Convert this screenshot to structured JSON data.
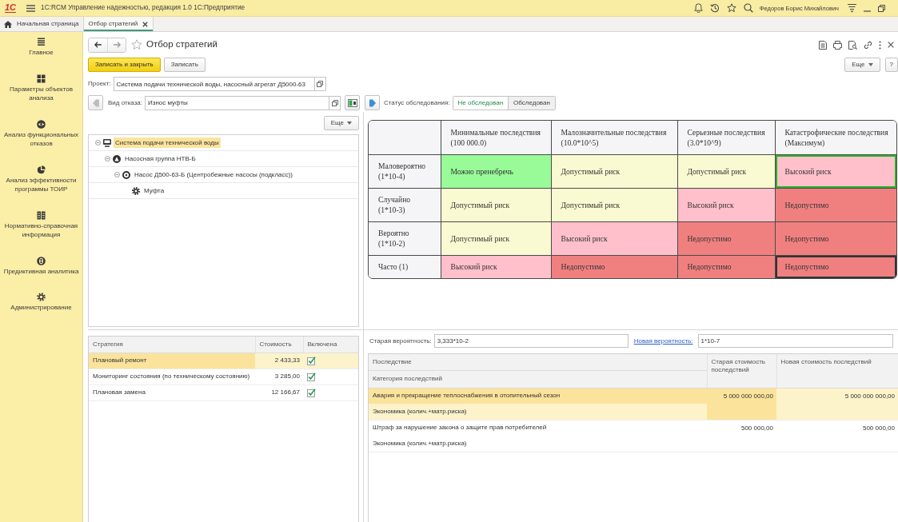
{
  "window": {
    "logo": "1С",
    "title": "1С:RCM Управление надежностью, редакция 1.0 1С:Предприятие",
    "user": "Федоров Борис Михайлович"
  },
  "tabs": [
    {
      "label": "Начальная страница",
      "kind": "home",
      "selected": false
    },
    {
      "label": "Отбор стратегий",
      "kind": "form",
      "selected": true
    }
  ],
  "sidebar": {
    "items": [
      "Главное",
      "Параметры объектов анализа",
      "Анализ функциональных отказов",
      "Анализ эффективности программы ТОИР",
      "Нормативно-справочная информация",
      "Предиктивная аналитика",
      "Администрирование"
    ]
  },
  "form": {
    "title": "Отбор стратегий",
    "save_close_button": "Записать и закрыть",
    "save_button": "Записать",
    "more_button": "Еще",
    "help_button": "?",
    "project": {
      "label": "Проект:",
      "value": "Система подачи технической воды, насосный агрегат Д5000-63"
    },
    "failure_type": {
      "label": "Вид отказа:",
      "value": "Износ муфты"
    },
    "survey_status": {
      "label": "Статус обследования:",
      "options": [
        {
          "label": "Не обследован",
          "selected": true
        },
        {
          "label": "Обследован",
          "selected": false
        }
      ]
    }
  },
  "tree": {
    "more_button": "Еще",
    "nodes": [
      {
        "label": "Система подачи технической воды",
        "expanded": true,
        "selected": true,
        "children": [
          {
            "label": "Насосная группа НТВ-Б",
            "expanded": true,
            "selected": false,
            "children": [
              {
                "label": "Насос Д500-63-Б (Центробежные насосы (подкласс))",
                "expanded": true,
                "selected": false,
                "children": [
                  {
                    "label": "Муфта",
                    "selected": false
                  }
                ]
              }
            ]
          }
        ]
      }
    ]
  },
  "risk_matrix": {
    "columns": [
      "Минимальные последствия (100 000.0)",
      "Малозначительные последствия (10.0*10^5)",
      "Серьезные последствия (3.0*10^9)",
      "Катастрофические последствия (Максимум)"
    ],
    "rows": [
      {
        "label": "Маловероятно (1*10-4)",
        "cells": [
          {
            "text": "Можно пренебречь",
            "color": "#98fb98",
            "selected": false,
            "focused": false
          },
          {
            "text": "Допустимый риск",
            "color": "#fafad2",
            "selected": false,
            "focused": false
          },
          {
            "text": "Допустимый риск",
            "color": "#fafad2",
            "selected": false,
            "focused": false
          },
          {
            "text": "Высокий риск",
            "color": "#ffc0cb",
            "selected": true,
            "focused": false
          }
        ]
      },
      {
        "label": "Случайно (1*10-3)",
        "cells": [
          {
            "text": "Допустимый риск",
            "color": "#fafad2",
            "selected": false,
            "focused": false
          },
          {
            "text": "Допустимый риск",
            "color": "#fafad2",
            "selected": false,
            "focused": false
          },
          {
            "text": "Высокий риск",
            "color": "#ffc0cb",
            "selected": false,
            "focused": false
          },
          {
            "text": "Недопустимо",
            "color": "#f08080",
            "selected": false,
            "focused": false
          }
        ]
      },
      {
        "label": "Вероятно (1*10-2)",
        "cells": [
          {
            "text": "Допустимый риск",
            "color": "#fafad2",
            "selected": false,
            "focused": false
          },
          {
            "text": "Высокий риск",
            "color": "#ffc0cb",
            "selected": false,
            "focused": false
          },
          {
            "text": "Недопустимо",
            "color": "#f08080",
            "selected": false,
            "focused": false
          },
          {
            "text": "Недопустимо",
            "color": "#f08080",
            "selected": false,
            "focused": false
          }
        ]
      },
      {
        "label": "Часто (1)",
        "cells": [
          {
            "text": "Высокий риск",
            "color": "#ffc0cb",
            "selected": false,
            "focused": false
          },
          {
            "text": "Недопустимо",
            "color": "#f08080",
            "selected": false,
            "focused": false
          },
          {
            "text": "Недопустимо",
            "color": "#f08080",
            "selected": false,
            "focused": false
          },
          {
            "text": "Недопустимо",
            "color": "#f08080",
            "selected": false,
            "focused": true
          }
        ]
      }
    ]
  },
  "strategies": {
    "columns": [
      "Стратегия",
      "Стоимость",
      "Включена"
    ],
    "rows": [
      {
        "name": "Плановый ремонт",
        "cost": "2 433,33",
        "included": true,
        "selected": true
      },
      {
        "name": "Мониторинг состояния (по техническому состоянию)",
        "cost": "3 285,00",
        "included": true,
        "selected": false
      },
      {
        "name": "Плановая замена",
        "cost": "12 166,67",
        "included": true,
        "selected": false
      }
    ]
  },
  "probability": {
    "old_label": "Старая вероятность:",
    "old_value": "3,333*10-2",
    "new_label": "Новая вероятность:",
    "new_value": "1*10-7"
  },
  "consequences": {
    "columns": [
      "Последствие",
      "Категория последствий",
      "Старая стоимость последствий",
      "Новая стоимость последствий"
    ],
    "rows": [
      {
        "consequence": "Авария и прекращение теплоснабжения в отопительный сезон",
        "category": "Экономика (колич.+матр.риска)",
        "old_cost": "5 000 000 000,00",
        "new_cost": "5 000 000 000,00",
        "selected": true
      },
      {
        "consequence": "Штраф за нарушение закона о защите прав потребителей",
        "category": "Экономика (колич.+матр.риска)",
        "old_cost": "500 000,00",
        "new_cost": "500 000,00",
        "selected": false
      }
    ]
  }
}
